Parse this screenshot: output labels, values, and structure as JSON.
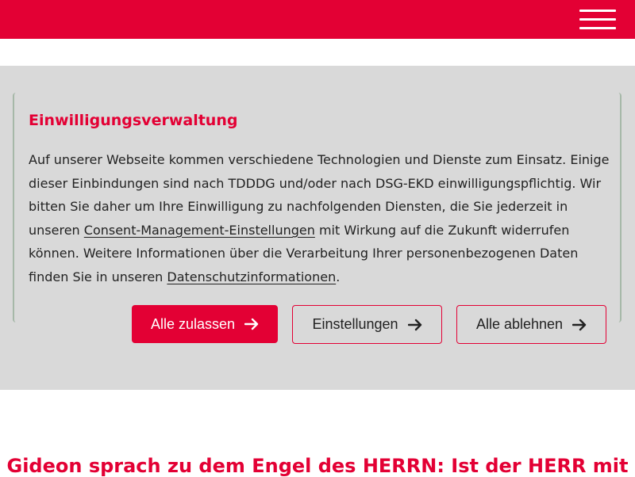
{
  "colors": {
    "brand": "#e30034",
    "band_background": "#d9d9d9",
    "text": "#222222"
  },
  "header": {
    "menu_icon": "hamburger-menu-icon"
  },
  "consent": {
    "title": "Einwilligungsverwaltung",
    "text_part1": "Auf unserer Webseite kommen verschiedene Technologien und Dienste zum Einsatz. Einige dieser Einbindungen sind nach TDDDG und/oder nach DSG-EKD einwilligungspflichtig. Wir bitten Sie daher um Ihre Einwilligung zu nachfolgenden Diensten, die Sie jederzeit in unseren ",
    "link_settings": "Consent-Management-Einstellungen",
    "text_part2": " mit Wirkung auf die Zukunft widerrufen können. Weitere Informationen über die Verarbeitung Ihrer personenbezogenen Daten finden Sie in unseren ",
    "link_privacy": "Datenschutzinformationen",
    "text_part3": ".",
    "buttons": {
      "accept_all": "Alle zulassen",
      "settings": "Einstellungen",
      "reject_all": "Alle ablehnen",
      "icon": "arrow-right-icon"
    }
  },
  "main": {
    "heading": "Gideon sprach zu dem Engel des HERRN: Ist der HERR mit"
  }
}
